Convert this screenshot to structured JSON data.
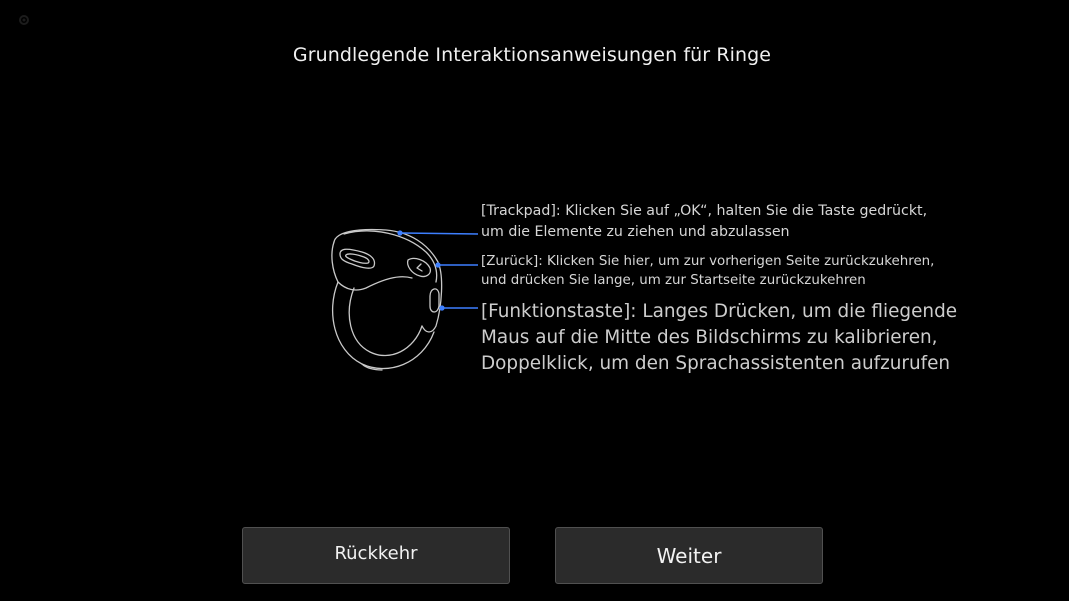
{
  "header": {
    "title": "Grundlegende Interaktionsanweisungen für Ringe"
  },
  "illustration": {
    "icon": "smart-ring-icon",
    "accent_color": "#3d7fff"
  },
  "instructions": {
    "trackpad": {
      "line1": "[Trackpad]: Klicken Sie auf „OK“, halten Sie die Taste gedrückt,",
      "line2": "um die Elemente zu ziehen und abzulassen"
    },
    "back": {
      "line1": "[Zurück]: Klicken Sie hier, um zur vorherigen Seite zurückzukehren,",
      "line2": "und drücken Sie lange, um zur Startseite zurückzukehren"
    },
    "function_key": {
      "line1": "[Funktionstaste]: Langes Drücken, um die fliegende",
      "line2": "Maus auf die Mitte des Bildschirms zu kalibrieren,",
      "line3": "Doppelklick, um den Sprachassistenten aufzurufen"
    }
  },
  "buttons": {
    "back_label": "Rückkehr",
    "next_label": "Weiter"
  }
}
